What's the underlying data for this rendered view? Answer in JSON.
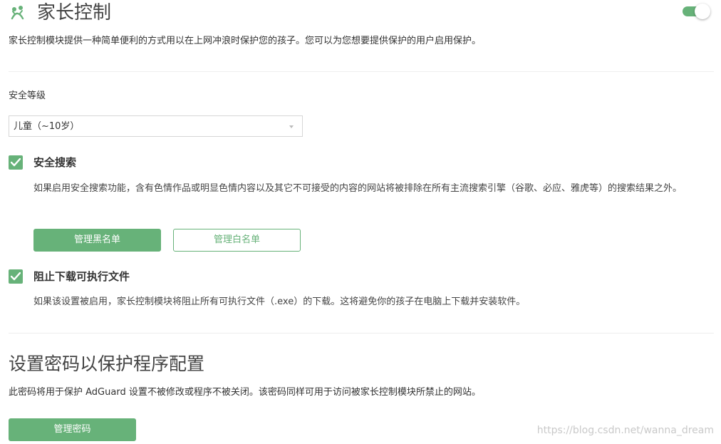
{
  "header": {
    "title": "家长控制",
    "icon": "parental-control-icon",
    "toggle_on": true
  },
  "description": "家长控制模块提供一种简单便利的方式用以在上网冲浪时保护您的孩子。您可以为您想要提供保护的用户启用保护。",
  "safety_level": {
    "label": "安全等级",
    "selected": "儿童（~10岁）"
  },
  "safe_search": {
    "checked": true,
    "title": "安全搜索",
    "description": "如果启用安全搜索功能，含有色情作品或明显色情内容以及其它不可接受的内容的网站将被排除在所有主流搜索引擎（谷歌、必应、雅虎等）的搜索结果之外。",
    "blacklist_button": "管理黑名单",
    "whitelist_button": "管理白名单"
  },
  "block_exe": {
    "checked": true,
    "title": "阻止下载可执行文件",
    "description": "如果该设置被启用，家长控制模块将阻止所有可执行文件（.exe）的下载。这将避免你的孩子在电脑上下载并安装软件。"
  },
  "password": {
    "title": "设置密码以保护程序配置",
    "description": "此密码将用于保护 AdGuard 设置不被修改或程序不被关闭。该密码同样可用于访问被家长控制模块所禁止的网站。",
    "button": "管理密码"
  },
  "watermark": "https://blog.csdn.net/wanna_dream",
  "colors": {
    "accent": "#67b279",
    "text": "#333333",
    "divider": "#eeeeee"
  }
}
